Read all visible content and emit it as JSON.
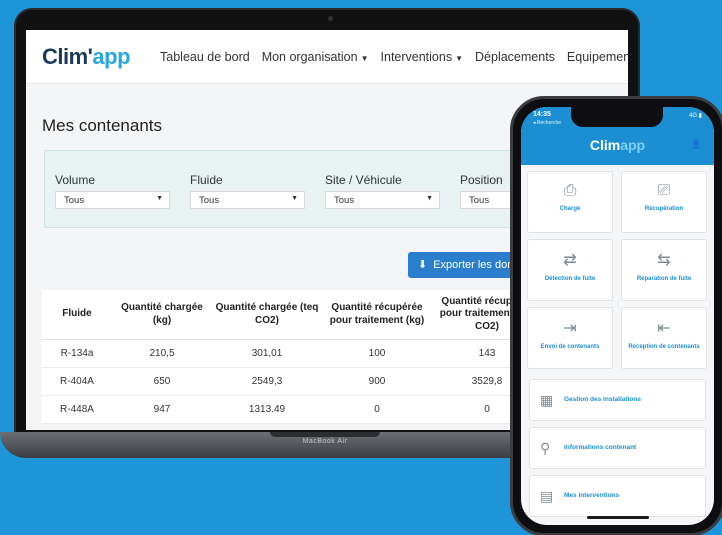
{
  "laptop": {
    "base_label": "MacBook Air",
    "app": {
      "logo_main": "Clim'",
      "logo_accent": "app",
      "nav": [
        {
          "label": "Tableau de bord",
          "caret": false
        },
        {
          "label": "Mon organisation",
          "caret": true
        },
        {
          "label": "Interventions",
          "caret": true
        },
        {
          "label": "Déplacements",
          "caret": false
        },
        {
          "label": "Equipements",
          "caret": true
        }
      ],
      "page_title": "Mes contenants",
      "filters": [
        {
          "label": "Volume",
          "value": "Tous"
        },
        {
          "label": "Fluide",
          "value": "Tous"
        },
        {
          "label": "Site / Véhicule",
          "value": "Tous"
        },
        {
          "label": "Position",
          "value": "Tous"
        }
      ],
      "export_label": "Exporter les données",
      "table": {
        "headers": [
          "Fluide",
          "Quantité chargée (kg)",
          "Quantité chargée (teq CO2)",
          "Quantité récupérée pour traitement (kg)",
          "Quantité récupérée pour traitement (teq CO2)"
        ],
        "rows": [
          [
            "R-134a",
            "210,5",
            "301,01",
            "100",
            "143"
          ],
          [
            "R-404A",
            "650",
            "2549,3",
            "900",
            "3529,8"
          ],
          [
            "R-448A",
            "947",
            "1313.49",
            "0",
            "0"
          ]
        ]
      }
    }
  },
  "phone": {
    "time": "14:35",
    "back_label": "◂ Recherche",
    "status": "4G ▮",
    "logo_main": "Clim",
    "logo_accent": "app",
    "tiles": [
      {
        "label": "Charge",
        "icon": "cylinder-in-icon"
      },
      {
        "label": "Récupération",
        "icon": "cylinder-out-icon"
      },
      {
        "label": "Détection de fuite",
        "icon": "leak-detect-icon"
      },
      {
        "label": "Réparation de fuite",
        "icon": "leak-repair-icon"
      },
      {
        "label": "Envoi de contenants",
        "icon": "send-container-icon"
      },
      {
        "label": "Réception de contenants",
        "icon": "receive-container-icon"
      }
    ],
    "list": [
      {
        "label": "Gestion des installations",
        "icon": "installations-icon"
      },
      {
        "label": "Informations contenant",
        "icon": "container-info-icon"
      },
      {
        "label": "Mes interventions",
        "icon": "interventions-icon"
      }
    ]
  }
}
